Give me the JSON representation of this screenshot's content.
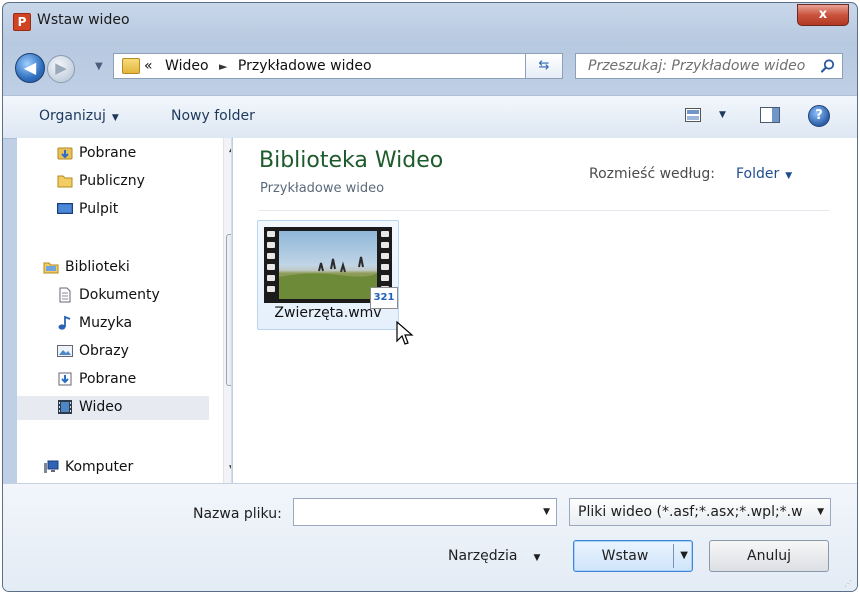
{
  "window": {
    "app_icon": "P",
    "title": "Wstaw wideo",
    "close_label": "x"
  },
  "nav": {
    "back_glyph": "◀",
    "forward_glyph": "▶",
    "history_glyph": "▼"
  },
  "address": {
    "prefix": "«",
    "segments": [
      "Wideo",
      "Przykładowe wideo"
    ],
    "separator": "►"
  },
  "search": {
    "placeholder": "Przeszukaj: Przykładowe wideo"
  },
  "toolbar": {
    "organize": "Organizuj",
    "new_folder": "Nowy folder",
    "help": "?"
  },
  "sidebar": {
    "items": [
      {
        "label": "Pobrane",
        "icon": "downloads-folder-icon"
      },
      {
        "label": "Publiczny",
        "icon": "folder-icon"
      },
      {
        "label": "Pulpit",
        "icon": "desktop-icon"
      },
      {
        "label": "Biblioteki",
        "icon": "libraries-icon"
      },
      {
        "label": "Dokumenty",
        "icon": "documents-icon"
      },
      {
        "label": "Muzyka",
        "icon": "music-icon"
      },
      {
        "label": "Obrazy",
        "icon": "pictures-icon"
      },
      {
        "label": "Pobrane",
        "icon": "downloads-icon"
      },
      {
        "label": "Wideo",
        "icon": "video-icon",
        "selected": true
      },
      {
        "label": "Komputer",
        "icon": "computer-icon"
      }
    ]
  },
  "content": {
    "library_title": "Biblioteka Wideo",
    "library_subtitle": "Przykładowe wideo",
    "arrange_label": "Rozmieść według:",
    "arrange_value": "Folder",
    "files": [
      {
        "name": "Zwierzęta.wmv",
        "badge": "321"
      }
    ]
  },
  "bottom": {
    "filename_label": "Nazwa pliku:",
    "filename_value": "",
    "filetype_value": "Pliki wideo (*.asf;*.asx;*.wpl;*.w",
    "tools_label": "Narzędzia",
    "insert_label": "Wstaw",
    "cancel_label": "Anuluj"
  },
  "colors": {
    "accent": "#1e5b2c",
    "link": "#1e4e8c",
    "selection": "#e7ebf1"
  }
}
